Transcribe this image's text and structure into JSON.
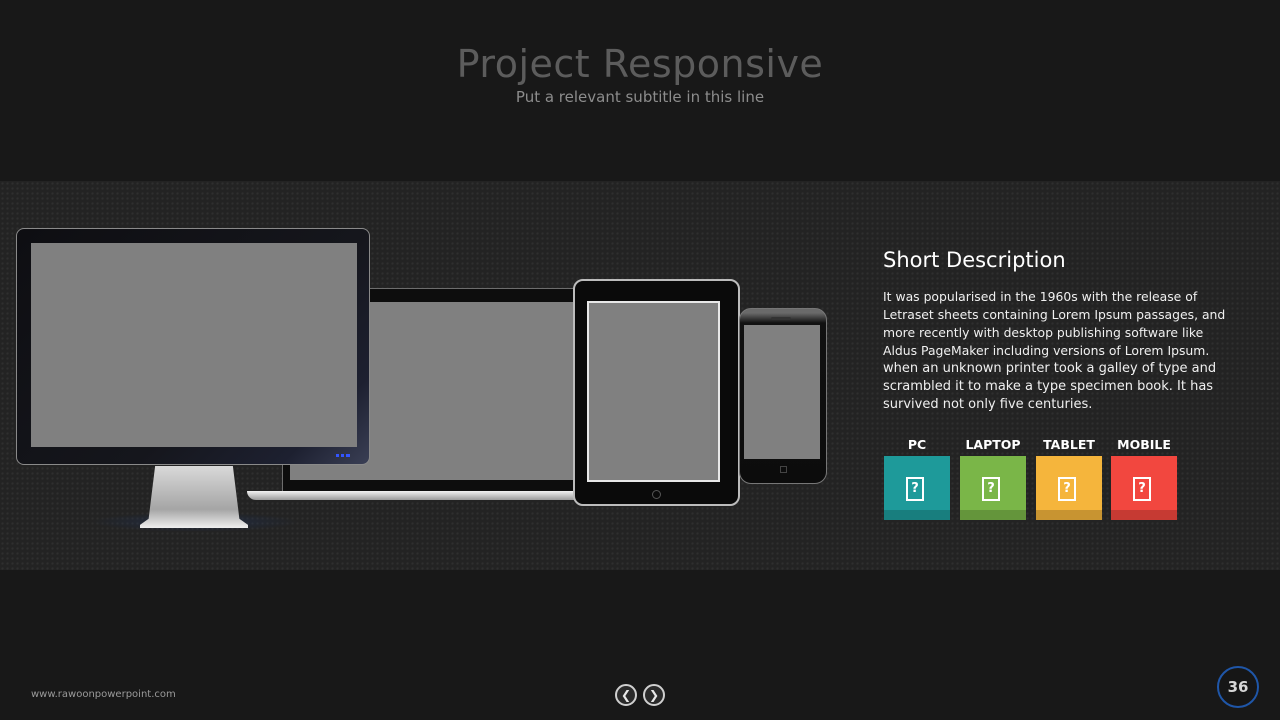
{
  "slide": {
    "title": "Project Responsive",
    "subtitle": "Put a relevant subtitle in this line"
  },
  "description": {
    "heading": "Short Description",
    "lines": [
      "It was popularised in the 1960s with the release of",
      "Letraset sheets containing Lorem Ipsum passages, and",
      "more recently with desktop publishing software like",
      "Aldus PageMaker including versions of Lorem Ipsum.",
      "when an unknown  printer took a galley of type and",
      "scrambled it to make a type specimen book. It has",
      "survived not only five centuries."
    ]
  },
  "tiles": [
    {
      "label": "PC",
      "color": "#1e9a9a",
      "icon": "device-icon"
    },
    {
      "label": "LAPTOP",
      "color": "#7ab648",
      "icon": "device-icon"
    },
    {
      "label": "TABLET",
      "color": "#f5b53c",
      "icon": "device-icon"
    },
    {
      "label": "MOBILE",
      "color": "#f2473f",
      "icon": "device-icon"
    }
  ],
  "tile_icon_glyph": "?",
  "footer": {
    "url": "www.rawoonpowerpoint.com",
    "prev_icon": "chevron-left-icon",
    "next_icon": "chevron-right-icon",
    "prev_glyph": "❮",
    "next_glyph": "❯",
    "page_number": "36"
  },
  "colors": {
    "background": "#181818",
    "band": "#232323",
    "page_badge_ring": "#1f56a8"
  }
}
